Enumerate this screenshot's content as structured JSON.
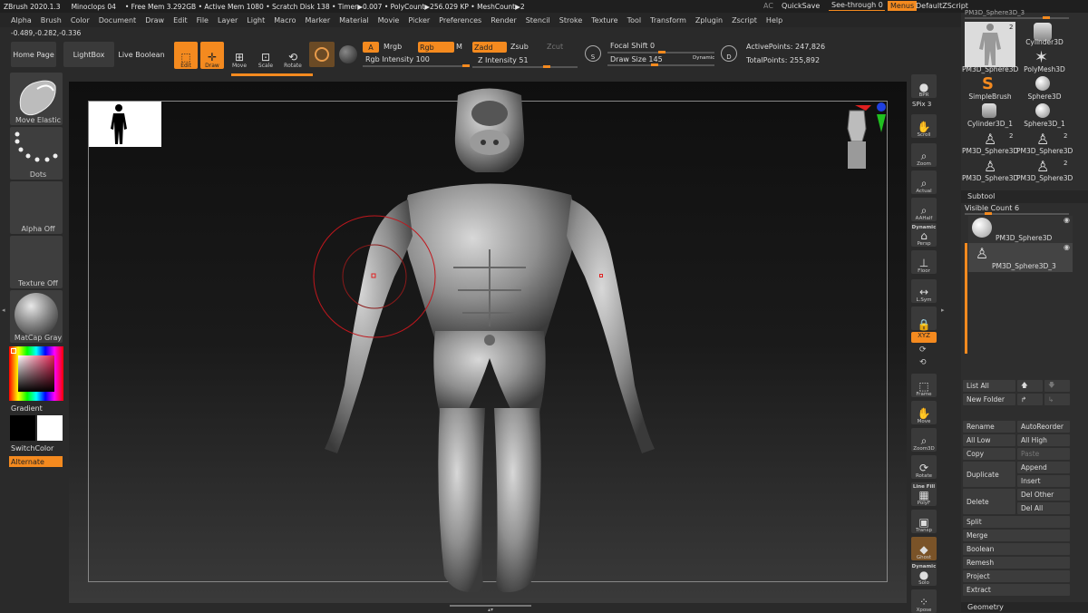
{
  "title_bar": {
    "items": [
      "ZBrush 2020.1.3",
      "Minoclops 04",
      "• Free Mem 3.292GB • Active Mem 1080 • Scratch Disk 138 • Timer▶0.007 • PolyCount▶256.029 KP • MeshCount▶2"
    ],
    "ac": "AC",
    "quicksave": "QuickSave",
    "see_through": "See-through  0",
    "menus": "Menus",
    "default_zscript": "DefaultZScript"
  },
  "menu_bar": [
    "Alpha",
    "Brush",
    "Color",
    "Document",
    "Draw",
    "Edit",
    "File",
    "Layer",
    "Light",
    "Macro",
    "Marker",
    "Material",
    "Movie",
    "Picker",
    "Preferences",
    "Render",
    "Stencil",
    "Stroke",
    "Texture",
    "Tool",
    "Transform",
    "Zplugin",
    "Zscript",
    "Help"
  ],
  "coords": "-0.489,-0.282,-0.336",
  "top_shelf": {
    "home_page": "Home Page",
    "lightbox": "LightBox",
    "live_boolean": "Live Boolean",
    "edit": "Edit",
    "draw": "Draw",
    "move": "Move",
    "scale": "Scale",
    "rotate": "Rotate",
    "a": "A",
    "mrgb": "Mrgb",
    "rgb": "Rgb",
    "m": "M",
    "zadd": "Zadd",
    "zsub": "Zsub",
    "zcut": "Zcut",
    "rgb_intensity": "Rgb Intensity 100",
    "z_intensity": "Z Intensity 51",
    "focal_shift": "Focal Shift 0",
    "draw_size": "Draw Size 145",
    "dynamic": "Dynamic",
    "active_points": "ActivePoints: 247,826",
    "total_points": "TotalPoints: 255,892",
    "rgb_intensity_value": 100,
    "z_intensity_value": 51,
    "draw_size_value": 145
  },
  "left_bar": {
    "brush": "Move Elastic",
    "stroke": "Dots",
    "alpha": "Alpha Off",
    "texture": "Texture Off",
    "material": "MatCap Gray",
    "gradient": "Gradient",
    "switch_color": "SwitchColor",
    "alternate": "Alternate"
  },
  "right_shelf": [
    "BPR",
    "SPix 3",
    "Scroll",
    "Zoom",
    "Actual",
    "AAHalf",
    "Dynamic",
    "Persp",
    "Floor",
    "L.Sym",
    "XYZ",
    "Frame",
    "Move",
    "Zoom3D",
    "Rotate",
    "Line Fill",
    "PolyF",
    "Transp",
    "Ghost",
    "Dynamic",
    "Solo",
    "Xpose"
  ],
  "tool_palette": {
    "header": "PM3D_Sphere3D_3",
    "thumbs": [
      {
        "label": "PM3D_Sphere3D",
        "badge": "2"
      },
      {
        "label": "Cylinder3D",
        "badge": ""
      },
      {
        "label": "PolyMesh3D",
        "badge": ""
      },
      {
        "label": "SimpleBrush",
        "badge": ""
      },
      {
        "label": "Sphere3D",
        "badge": ""
      },
      {
        "label": "Cylinder3D_1",
        "badge": ""
      },
      {
        "label": "Sphere3D_1",
        "badge": ""
      },
      {
        "label": "PM3D_Sphere3D",
        "badge": "2"
      },
      {
        "label": "PM3D_Sphere3D",
        "badge": "2"
      },
      {
        "label": "PM3D_Sphere3D",
        "badge": ""
      },
      {
        "label": "PM3D_Sphere3D",
        "badge": "2"
      }
    ]
  },
  "subtool": {
    "title": "Subtool",
    "visible_count": "Visible Count 6",
    "items": [
      "PM3D_Sphere3D",
      "PM3D_Sphere3D_3"
    ],
    "list_all": "List All",
    "new_folder": "New Folder",
    "rename": "Rename",
    "auto_reorder": "AutoReorder",
    "all_low": "All Low",
    "all_high": "All High",
    "copy": "Copy",
    "paste": "Paste",
    "duplicate": "Duplicate",
    "append": "Append",
    "insert": "Insert",
    "delete": "Delete",
    "del_other": "Del Other",
    "del_all": "Del All",
    "split": "Split",
    "merge": "Merge",
    "boolean": "Boolean",
    "remesh": "Remesh",
    "project": "Project",
    "extract": "Extract",
    "geometry": "Geometry"
  }
}
